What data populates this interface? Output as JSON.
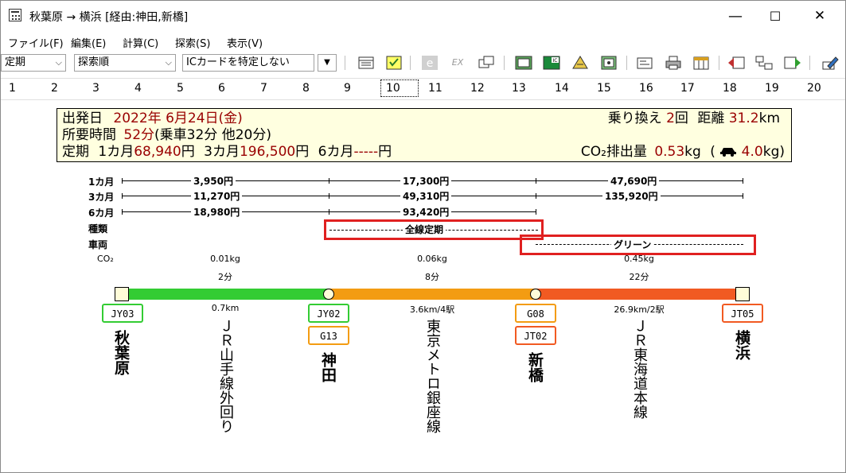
{
  "window": {
    "title": "秋葉原 → 横浜 [経由:神田,新橋]",
    "minimize": "—",
    "maximize": "☐",
    "close": "✕"
  },
  "menu": [
    "ファイル(F)",
    "編集(E)",
    "計算(C)",
    "探索(S)",
    "表示(V)"
  ],
  "toolbar": {
    "ticket_type": "定期",
    "sort_order": "探索順",
    "ic_card": "ICカードを特定しない",
    "ex_label": "EX"
  },
  "route_tabs": [
    "1",
    "2",
    "3",
    "4",
    "5",
    "6",
    "7",
    "8",
    "9",
    "10",
    "11",
    "12",
    "13",
    "14",
    "15",
    "16",
    "17",
    "18",
    "19",
    "20"
  ],
  "active_tab": "10",
  "summary": {
    "depart_label": "出発日",
    "depart_date": "2022年 6月24日(金)",
    "time_label": "所要時間",
    "time_value": "52分",
    "time_detail": "(乗車32分 他20分)",
    "pass_label": "定期",
    "pass_1m_label": "1カ月",
    "pass_1m": "68,940",
    "pass_3m_label": "3カ月",
    "pass_3m": "196,500",
    "pass_6m_label": "6カ月",
    "pass_6m": "-----",
    "yen": "円",
    "transfer_label": "乗り換え",
    "transfer_count": "2",
    "transfer_unit": "回",
    "distance_label": "距離",
    "distance_value": "31.2",
    "distance_unit": "km",
    "co2_label": "CO₂排出量",
    "co2_value": "0.53",
    "co2_unit": "kg",
    "co2_car_open": "(",
    "co2_car_value": "4.0",
    "co2_car_unit": "kg)"
  },
  "fare_rows": {
    "labels": [
      "1カ月",
      "3カ月",
      "6カ月",
      "種類",
      "車両",
      "CO₂"
    ],
    "m1": [
      "3,950円",
      "17,300円",
      "47,690円"
    ],
    "m3": [
      "11,270円",
      "49,310円",
      "135,920円"
    ],
    "m6": [
      "18,980円",
      "93,420円"
    ],
    "kind": "全線定期",
    "car": "グリーン"
  },
  "sections": [
    {
      "co2": "0.01kg",
      "time": "2分",
      "dist": "0.7km",
      "line": "ＪＲ山手線外回り",
      "color": "#33cc33"
    },
    {
      "co2": "0.06kg",
      "time": "8分",
      "dist": "3.6km/4駅",
      "line": "東京メトロ銀座線",
      "color": "#f39c12"
    },
    {
      "co2": "0.45kg",
      "time": "22分",
      "dist": "26.9km/2駅",
      "line": "ＪＲ東海道本線",
      "color": "#f15a22"
    }
  ],
  "stations": [
    {
      "name": "秋葉原",
      "codes": [
        "JY03"
      ]
    },
    {
      "name": "神田",
      "codes": [
        "JY02",
        "G13"
      ]
    },
    {
      "name": "新橋",
      "codes": [
        "G08",
        "JT02"
      ]
    },
    {
      "name": "横浜",
      "codes": [
        "JT05"
      ]
    }
  ]
}
